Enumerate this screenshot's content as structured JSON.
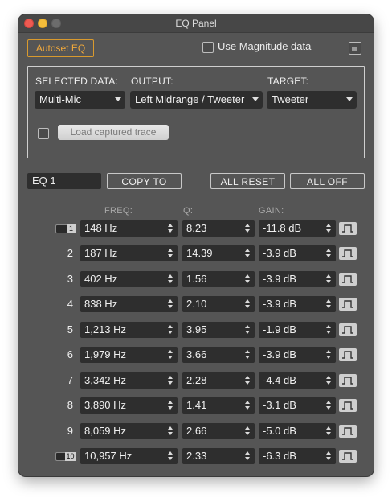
{
  "window": {
    "title": "EQ Panel"
  },
  "autoset": {
    "tab_label": "Autoset EQ"
  },
  "magnitude": {
    "checkbox_label": "Use Magnitude data"
  },
  "selection": {
    "selected_data_label": "SELECTED DATA:",
    "selected_data_value": "Multi-Mic",
    "output_label": "OUTPUT:",
    "output_value": "Left Midrange / Tweeter",
    "target_label": "TARGET:",
    "target_value": "Tweeter",
    "load_button": "Load captured trace"
  },
  "eq": {
    "name_value": "EQ 1",
    "copy_to": "COPY TO",
    "all_reset": "ALL RESET",
    "all_off": "ALL OFF"
  },
  "columns": {
    "freq": "FREQ:",
    "q": "Q:",
    "gain": "GAIN:"
  },
  "bands": [
    {
      "num": "1",
      "freq": "148 Hz",
      "q": "8.23",
      "gain": "-11.8 dB"
    },
    {
      "num": "2",
      "freq": "187 Hz",
      "q": "14.39",
      "gain": "-3.9 dB"
    },
    {
      "num": "3",
      "freq": "402 Hz",
      "q": "1.56",
      "gain": "-3.9 dB"
    },
    {
      "num": "4",
      "freq": "838 Hz",
      "q": "2.10",
      "gain": "-3.9 dB"
    },
    {
      "num": "5",
      "freq": "1,213 Hz",
      "q": "3.95",
      "gain": "-1.9 dB"
    },
    {
      "num": "6",
      "freq": "1,979 Hz",
      "q": "3.66",
      "gain": "-3.9 dB"
    },
    {
      "num": "7",
      "freq": "3,342 Hz",
      "q": "2.28",
      "gain": "-4.4 dB"
    },
    {
      "num": "8",
      "freq": "3,890 Hz",
      "q": "1.41",
      "gain": "-3.1 dB"
    },
    {
      "num": "9",
      "freq": "8,059 Hz",
      "q": "2.66",
      "gain": "-5.0 dB"
    },
    {
      "num": "10",
      "freq": "10,957 Hz",
      "q": "2.33",
      "gain": "-6.3 dB"
    }
  ],
  "colors": {
    "accent": "#f2a93b",
    "panel": "#555555",
    "field": "#2e2e2e"
  },
  "icons": {
    "filter_button": "peak-filter-icon"
  }
}
